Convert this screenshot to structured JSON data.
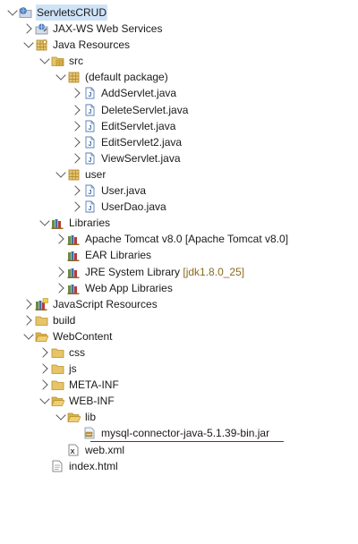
{
  "tree": [
    {
      "depth": 0,
      "toggle": "exp",
      "icon": "web-project",
      "name": "tree-node-servletscrud",
      "label": "ServletsCRUD",
      "selected": true
    },
    {
      "depth": 1,
      "toggle": "col",
      "icon": "web-services",
      "name": "tree-node-jax-ws",
      "label": "JAX-WS Web Services"
    },
    {
      "depth": 1,
      "toggle": "exp",
      "icon": "java-resources",
      "name": "tree-node-java-resources",
      "label": "Java Resources"
    },
    {
      "depth": 2,
      "toggle": "exp",
      "icon": "src-folder",
      "name": "tree-node-src",
      "label": "src"
    },
    {
      "depth": 3,
      "toggle": "exp",
      "icon": "package",
      "name": "tree-node-default-package",
      "label": "(default package)"
    },
    {
      "depth": 4,
      "toggle": "col",
      "icon": "java-file",
      "name": "tree-node-addservlet",
      "label": "AddServlet.java"
    },
    {
      "depth": 4,
      "toggle": "col",
      "icon": "java-file",
      "name": "tree-node-deleteservlet",
      "label": "DeleteServlet.java"
    },
    {
      "depth": 4,
      "toggle": "col",
      "icon": "java-file",
      "name": "tree-node-editservlet",
      "label": "EditServlet.java"
    },
    {
      "depth": 4,
      "toggle": "col",
      "icon": "java-file",
      "name": "tree-node-editservlet2",
      "label": "EditServlet2.java"
    },
    {
      "depth": 4,
      "toggle": "col",
      "icon": "java-file",
      "name": "tree-node-viewservlet",
      "label": "ViewServlet.java"
    },
    {
      "depth": 3,
      "toggle": "exp",
      "icon": "package",
      "name": "tree-node-user-package",
      "label": "user"
    },
    {
      "depth": 4,
      "toggle": "col",
      "icon": "java-file",
      "name": "tree-node-user-java",
      "label": "User.java"
    },
    {
      "depth": 4,
      "toggle": "col",
      "icon": "java-file",
      "name": "tree-node-userdao",
      "label": "UserDao.java"
    },
    {
      "depth": 2,
      "toggle": "exp",
      "icon": "library",
      "name": "tree-node-libraries",
      "label": "Libraries"
    },
    {
      "depth": 3,
      "toggle": "col",
      "icon": "library",
      "name": "tree-node-tomcat",
      "label": "Apache Tomcat v8.0 [Apache Tomcat v8.0]"
    },
    {
      "depth": 3,
      "toggle": "none",
      "icon": "library",
      "name": "tree-node-ear-libraries",
      "label": "EAR Libraries"
    },
    {
      "depth": 3,
      "toggle": "col",
      "icon": "library",
      "name": "tree-node-jre",
      "label": "JRE System Library",
      "decoration": "[jdk1.8.0_25]"
    },
    {
      "depth": 3,
      "toggle": "col",
      "icon": "library",
      "name": "tree-node-webapp-libraries",
      "label": "Web App Libraries"
    },
    {
      "depth": 1,
      "toggle": "col",
      "icon": "js-resources",
      "name": "tree-node-javascript-resources",
      "label": "JavaScript Resources"
    },
    {
      "depth": 1,
      "toggle": "col",
      "icon": "folder",
      "name": "tree-node-build",
      "label": "build"
    },
    {
      "depth": 1,
      "toggle": "exp",
      "icon": "folder-open",
      "name": "tree-node-webcontent",
      "label": "WebContent"
    },
    {
      "depth": 2,
      "toggle": "col",
      "icon": "folder",
      "name": "tree-node-css",
      "label": "css"
    },
    {
      "depth": 2,
      "toggle": "col",
      "icon": "folder",
      "name": "tree-node-js",
      "label": "js"
    },
    {
      "depth": 2,
      "toggle": "col",
      "icon": "folder",
      "name": "tree-node-meta-inf",
      "label": "META-INF"
    },
    {
      "depth": 2,
      "toggle": "exp",
      "icon": "folder-open",
      "name": "tree-node-web-inf",
      "label": "WEB-INF"
    },
    {
      "depth": 3,
      "toggle": "exp",
      "icon": "folder-open",
      "name": "tree-node-lib",
      "label": "lib"
    },
    {
      "depth": 4,
      "toggle": "none",
      "icon": "jar-file",
      "name": "tree-node-mysql-jar",
      "label": "mysql-connector-java-5.1.39-bin.jar"
    },
    {
      "depth": 3,
      "toggle": "none",
      "icon": "xml-file",
      "name": "tree-node-web-xml",
      "label": "web.xml"
    },
    {
      "depth": 2,
      "toggle": "none",
      "icon": "html-file",
      "name": "tree-node-index-html",
      "label": "index.html"
    }
  ],
  "highlight_color": "#d40000",
  "selection_color": "#cfe3f8"
}
